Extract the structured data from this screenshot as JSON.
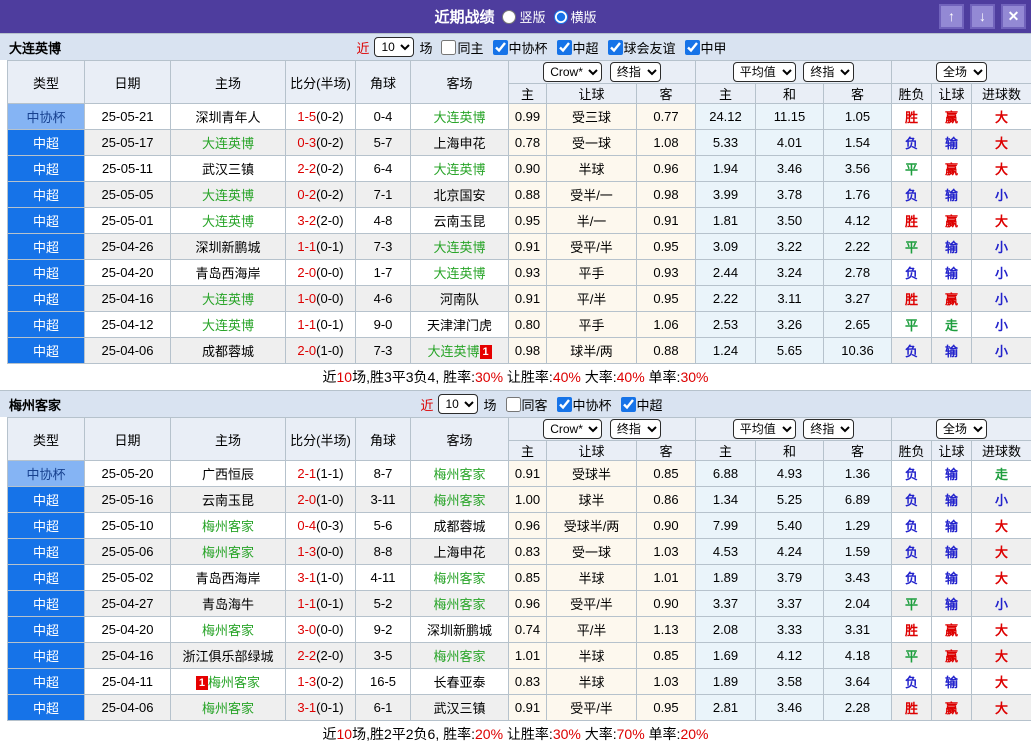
{
  "colors": {
    "red": "#dd0000",
    "green": "#1e9e3e",
    "blue": "#2323cc",
    "team_green": "#28a428",
    "accent_blue": "#1673e8",
    "titlebar": "#4e3d9e"
  },
  "result_colors": {
    "胜": "red",
    "平": "green",
    "负": "blue",
    "赢": "red",
    "输": "blue",
    "走": "green",
    "大": "red",
    "小": "blue"
  },
  "titlebar": {
    "title": "近期战绩",
    "radios": [
      {
        "label": "竖版",
        "checked": false
      },
      {
        "label": "横版",
        "checked": true
      }
    ],
    "buttons": {
      "up": "↑",
      "down": "↓",
      "close": "✕"
    }
  },
  "headers": {
    "left": [
      "类型",
      "日期",
      "主场",
      "比分(半场)",
      "角球",
      "客场"
    ],
    "sub": [
      "主",
      "让球",
      "客",
      "主",
      "和",
      "客",
      "胜负",
      "让球",
      "进球数"
    ]
  },
  "sections": [
    {
      "team": "大连英博",
      "filter": {
        "near": "近",
        "count": "10",
        "games": "场",
        "toggle": "同主",
        "toggle_checked": false,
        "leagues": [
          {
            "label": "中协杯",
            "checked": true
          },
          {
            "label": "中超",
            "checked": true
          },
          {
            "label": "球会友谊",
            "checked": true
          },
          {
            "label": "中甲",
            "checked": true
          }
        ]
      },
      "selects": {
        "odds_source": "Crow*",
        "odds_kind": "终指",
        "avg": "平均值",
        "avg_kind": "终指",
        "scope": "全场"
      },
      "rows": [
        {
          "league": "中协杯",
          "cup": true,
          "date": "25-05-21",
          "home": "深圳青年人",
          "score": "1-5",
          "half": "(0-2)",
          "corner": "0-4",
          "away": "大连英博",
          "odds": [
            "0.99",
            "受三球",
            "0.77"
          ],
          "avg": [
            "24.12",
            "11.15",
            "1.05"
          ],
          "res": [
            "胜",
            "赢",
            "大"
          ]
        },
        {
          "league": "中超",
          "date": "25-05-17",
          "home": "大连英博",
          "score": "0-3",
          "half": "(0-2)",
          "corner": "5-7",
          "away": "上海申花",
          "odds": [
            "0.78",
            "受一球",
            "1.08"
          ],
          "avg": [
            "5.33",
            "4.01",
            "1.54"
          ],
          "res": [
            "负",
            "输",
            "大"
          ]
        },
        {
          "league": "中超",
          "date": "25-05-11",
          "home": "武汉三镇",
          "score": "2-2",
          "half": "(0-2)",
          "corner": "6-4",
          "away": "大连英博",
          "odds": [
            "0.90",
            "半球",
            "0.96"
          ],
          "avg": [
            "1.94",
            "3.46",
            "3.56"
          ],
          "res": [
            "平",
            "赢",
            "大"
          ]
        },
        {
          "league": "中超",
          "date": "25-05-05",
          "home": "大连英博",
          "score": "0-2",
          "half": "(0-2)",
          "corner": "7-1",
          "away": "北京国安",
          "odds": [
            "0.88",
            "受半/一",
            "0.98"
          ],
          "avg": [
            "3.99",
            "3.78",
            "1.76"
          ],
          "res": [
            "负",
            "输",
            "小"
          ]
        },
        {
          "league": "中超",
          "date": "25-05-01",
          "home": "大连英博",
          "score": "3-2",
          "half": "(2-0)",
          "corner": "4-8",
          "away": "云南玉昆",
          "odds": [
            "0.95",
            "半/一",
            "0.91"
          ],
          "avg": [
            "1.81",
            "3.50",
            "4.12"
          ],
          "res": [
            "胜",
            "赢",
            "大"
          ]
        },
        {
          "league": "中超",
          "date": "25-04-26",
          "home": "深圳新鹏城",
          "score": "1-1",
          "half": "(0-1)",
          "corner": "7-3",
          "away": "大连英博",
          "odds": [
            "0.91",
            "受平/半",
            "0.95"
          ],
          "avg": [
            "3.09",
            "3.22",
            "2.22"
          ],
          "res": [
            "平",
            "输",
            "小"
          ]
        },
        {
          "league": "中超",
          "date": "25-04-20",
          "home": "青岛西海岸",
          "score": "2-0",
          "half": "(0-0)",
          "corner": "1-7",
          "away": "大连英博",
          "odds": [
            "0.93",
            "平手",
            "0.93"
          ],
          "avg": [
            "2.44",
            "3.24",
            "2.78"
          ],
          "res": [
            "负",
            "输",
            "小"
          ]
        },
        {
          "league": "中超",
          "date": "25-04-16",
          "home": "大连英博",
          "score": "1-0",
          "half": "(0-0)",
          "corner": "4-6",
          "away": "河南队",
          "odds": [
            "0.91",
            "平/半",
            "0.95"
          ],
          "avg": [
            "2.22",
            "3.11",
            "3.27"
          ],
          "res": [
            "胜",
            "赢",
            "小"
          ]
        },
        {
          "league": "中超",
          "date": "25-04-12",
          "home": "大连英博",
          "score": "1-1",
          "half": "(0-1)",
          "corner": "9-0",
          "away": "天津津门虎",
          "odds": [
            "0.80",
            "平手",
            "1.06"
          ],
          "avg": [
            "2.53",
            "3.26",
            "2.65"
          ],
          "res": [
            "平",
            "走",
            "小"
          ]
        },
        {
          "league": "中超",
          "date": "25-04-06",
          "home": "成都蓉城",
          "score": "2-0",
          "half": "(1-0)",
          "corner": "7-3",
          "away": "大连英博",
          "away_badge": "1",
          "away_badge_pos": "after",
          "odds": [
            "0.98",
            "球半/两",
            "0.88"
          ],
          "avg": [
            "1.24",
            "5.65",
            "10.36"
          ],
          "res": [
            "负",
            "输",
            "小"
          ]
        }
      ],
      "summary": [
        {
          "t": "近"
        },
        {
          "t": "10",
          "red": true
        },
        {
          "t": "场,胜3平3负4, 胜率:"
        },
        {
          "t": "30%",
          "red": true
        },
        {
          "t": " 让胜率:"
        },
        {
          "t": "40%",
          "red": true
        },
        {
          "t": " 大率:"
        },
        {
          "t": "40%",
          "red": true
        },
        {
          "t": " 单率:"
        },
        {
          "t": "30%",
          "red": true
        }
      ]
    },
    {
      "team": "梅州客家",
      "filter": {
        "near": "近",
        "count": "10",
        "games": "场",
        "toggle": "同客",
        "toggle_checked": false,
        "leagues": [
          {
            "label": "中协杯",
            "checked": true
          },
          {
            "label": "中超",
            "checked": true
          }
        ]
      },
      "selects": {
        "odds_source": "Crow*",
        "odds_kind": "终指",
        "avg": "平均值",
        "avg_kind": "终指",
        "scope": "全场"
      },
      "rows": [
        {
          "league": "中协杯",
          "cup": true,
          "date": "25-05-20",
          "home": "广西恒辰",
          "score": "2-1",
          "half": "(1-1)",
          "corner": "8-7",
          "away": "梅州客家",
          "odds": [
            "0.91",
            "受球半",
            "0.85"
          ],
          "avg": [
            "6.88",
            "4.93",
            "1.36"
          ],
          "res": [
            "负",
            "输",
            "走"
          ]
        },
        {
          "league": "中超",
          "date": "25-05-16",
          "home": "云南玉昆",
          "score": "2-0",
          "half": "(1-0)",
          "corner": "3-11",
          "away": "梅州客家",
          "odds": [
            "1.00",
            "球半",
            "0.86"
          ],
          "avg": [
            "1.34",
            "5.25",
            "6.89"
          ],
          "res": [
            "负",
            "输",
            "小"
          ]
        },
        {
          "league": "中超",
          "date": "25-05-10",
          "home": "梅州客家",
          "score": "0-4",
          "half": "(0-3)",
          "corner": "5-6",
          "away": "成都蓉城",
          "odds": [
            "0.96",
            "受球半/两",
            "0.90"
          ],
          "avg": [
            "7.99",
            "5.40",
            "1.29"
          ],
          "res": [
            "负",
            "输",
            "大"
          ]
        },
        {
          "league": "中超",
          "date": "25-05-06",
          "home": "梅州客家",
          "score": "1-3",
          "half": "(0-0)",
          "corner": "8-8",
          "away": "上海申花",
          "odds": [
            "0.83",
            "受一球",
            "1.03"
          ],
          "avg": [
            "4.53",
            "4.24",
            "1.59"
          ],
          "res": [
            "负",
            "输",
            "大"
          ]
        },
        {
          "league": "中超",
          "date": "25-05-02",
          "home": "青岛西海岸",
          "score": "3-1",
          "half": "(1-0)",
          "corner": "4-11",
          "away": "梅州客家",
          "odds": [
            "0.85",
            "半球",
            "1.01"
          ],
          "avg": [
            "1.89",
            "3.79",
            "3.43"
          ],
          "res": [
            "负",
            "输",
            "大"
          ]
        },
        {
          "league": "中超",
          "date": "25-04-27",
          "home": "青岛海牛",
          "score": "1-1",
          "half": "(0-1)",
          "corner": "5-2",
          "away": "梅州客家",
          "odds": [
            "0.96",
            "受平/半",
            "0.90"
          ],
          "avg": [
            "3.37",
            "3.37",
            "2.04"
          ],
          "res": [
            "平",
            "输",
            "小"
          ]
        },
        {
          "league": "中超",
          "date": "25-04-20",
          "home": "梅州客家",
          "score": "3-0",
          "half": "(0-0)",
          "corner": "9-2",
          "away": "深圳新鹏城",
          "odds": [
            "0.74",
            "平/半",
            "1.13"
          ],
          "avg": [
            "2.08",
            "3.33",
            "3.31"
          ],
          "res": [
            "胜",
            "赢",
            "大"
          ]
        },
        {
          "league": "中超",
          "date": "25-04-16",
          "home": "浙江俱乐部绿城",
          "score": "2-2",
          "half": "(2-0)",
          "corner": "3-5",
          "away": "梅州客家",
          "odds": [
            "1.01",
            "半球",
            "0.85"
          ],
          "avg": [
            "1.69",
            "4.12",
            "4.18"
          ],
          "res": [
            "平",
            "赢",
            "大"
          ]
        },
        {
          "league": "中超",
          "date": "25-04-11",
          "home": "梅州客家",
          "home_badge": "1",
          "home_badge_pos": "before",
          "score": "1-3",
          "half": "(0-2)",
          "corner": "16-5",
          "away": "长春亚泰",
          "odds": [
            "0.83",
            "半球",
            "1.03"
          ],
          "avg": [
            "1.89",
            "3.58",
            "3.64"
          ],
          "res": [
            "负",
            "输",
            "大"
          ]
        },
        {
          "league": "中超",
          "date": "25-04-06",
          "home": "梅州客家",
          "score": "3-1",
          "half": "(0-1)",
          "corner": "6-1",
          "away": "武汉三镇",
          "odds": [
            "0.91",
            "受平/半",
            "0.95"
          ],
          "avg": [
            "2.81",
            "3.46",
            "2.28"
          ],
          "res": [
            "胜",
            "赢",
            "大"
          ]
        }
      ],
      "summary": [
        {
          "t": "近"
        },
        {
          "t": "10",
          "red": true
        },
        {
          "t": "场,胜2平2负6, 胜率:"
        },
        {
          "t": "20%",
          "red": true
        },
        {
          "t": " 让胜率:"
        },
        {
          "t": "30%",
          "red": true
        },
        {
          "t": " 大率:"
        },
        {
          "t": "70%",
          "red": true
        },
        {
          "t": " 单率:"
        },
        {
          "t": "20%",
          "red": true
        }
      ]
    }
  ]
}
